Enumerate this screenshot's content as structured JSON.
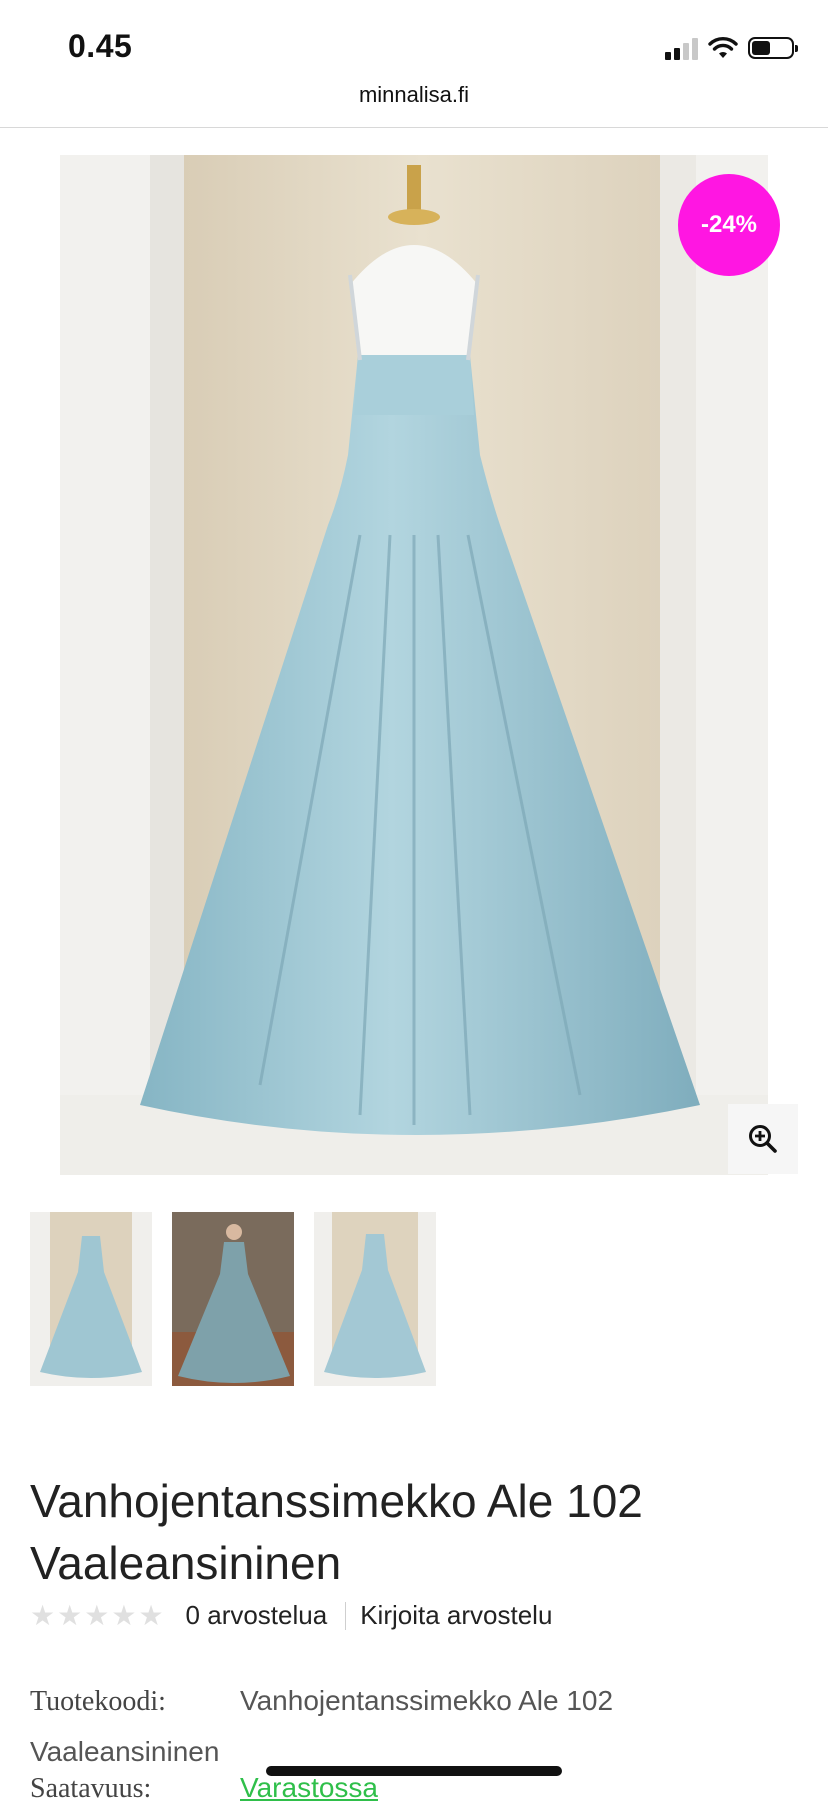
{
  "status_bar": {
    "time": "0.45"
  },
  "browser": {
    "url": "minnalisa.fi"
  },
  "product": {
    "sale_badge": "-24%",
    "title": "Vanhojentanssimekko Ale 102 Vaaleansininen",
    "rating": {
      "stars": 0,
      "max": 5,
      "reviews_label": "0 arvostelua",
      "write_review": "Kirjoita arvostelu"
    },
    "code_label": "Tuotekoodi:",
    "code_value": "Vanhojentanssimekko Ale 102 Vaaleansininen",
    "availability_label": "Saatavuus:",
    "availability_value": "Varastossa"
  },
  "colors": {
    "badge": "#ff16e2",
    "availability": "#2fbf4a",
    "dress": "#9fc6d2"
  },
  "icons": {
    "zoom": "zoom-in-icon",
    "star": "star-icon"
  }
}
